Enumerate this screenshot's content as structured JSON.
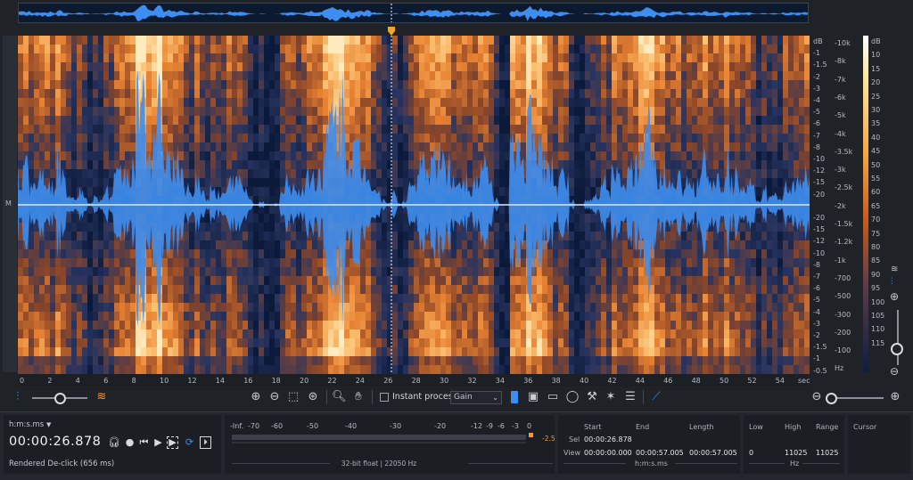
{
  "spectrogram": {
    "channel_label": "M",
    "time_ticks": [
      "0",
      "2",
      "4",
      "6",
      "8",
      "10",
      "12",
      "14",
      "16",
      "18",
      "20",
      "22",
      "24",
      "26",
      "28",
      "30",
      "32",
      "34",
      "36",
      "38",
      "40",
      "42",
      "44",
      "46",
      "48",
      "50",
      "52",
      "54",
      "sec"
    ],
    "db_ticks": [
      "dB",
      "-1",
      "-1.5",
      "-2",
      "-3",
      "-4",
      "-5",
      "-6",
      "-7",
      "-8",
      "-10",
      "-12",
      "-15",
      "-20",
      "",
      "-20",
      "-15",
      "-12",
      "-10",
      "-8",
      "-7",
      "-6",
      "-5",
      "-4",
      "-3",
      "-2",
      "-1.5",
      "-1",
      "-0.5"
    ],
    "hz_ticks": [
      "-10k",
      "-8k",
      "-7k",
      "-6k",
      "-5k",
      "-4k",
      "-3.5k",
      "-3k",
      "-2.5k",
      "-2k",
      "-1.5k",
      "-1.2k",
      "-1k",
      "-700",
      "-500",
      "-300",
      "-200",
      "-100",
      "Hz"
    ],
    "colorbar_ticks": [
      "dB",
      "10",
      "15",
      "20",
      "25",
      "30",
      "35",
      "40",
      "45",
      "50",
      "55",
      "60",
      "65",
      "70",
      "75",
      "80",
      "85",
      "90",
      "95",
      "100",
      "105",
      "110",
      "115"
    ],
    "colors": {
      "waveform": "#3d8ef0",
      "spectro_hot": "#f39a3a",
      "spectro_cold": "#0b1a3a",
      "playhead": "#f5a623"
    }
  },
  "toolbar": {
    "instant_process_label": "Instant process",
    "gain_select_value": "Gain",
    "icons": [
      "waveform-icon",
      "spectrogram-icon",
      "zoom-in-icon",
      "zoom-out-icon",
      "zoom-selection-icon",
      "zoom-fit-icon",
      "zoom-icon",
      "hand-icon",
      "time-select-icon",
      "rect-select-icon",
      "freq-select-icon",
      "lasso-icon",
      "magic-wand-icon",
      "brush-icon",
      "harmonics-icon",
      "link-icon",
      "zoom-out-v-icon",
      "zoom-in-v-icon"
    ]
  },
  "transport": {
    "time_format": "h:m:s.ms",
    "timecode": "00:00:26.878",
    "status": "Rendered De-click (656 ms)"
  },
  "meter": {
    "ticks": [
      "-Inf.",
      "-70",
      "-60",
      "-50",
      "-40",
      "-30",
      "-20",
      "-12",
      "-9",
      "-6",
      "-3",
      "0"
    ],
    "peak_value": "-2.5",
    "footer": "32-bit float | 22050 Hz"
  },
  "selection": {
    "start_header": "Start",
    "end_header": "End",
    "length_header": "Length",
    "sel_label": "Sel",
    "view_label": "View",
    "sel_start": "00:00:26.878",
    "view_start": "00:00:00.000",
    "view_end": "00:00:57.005",
    "view_length": "00:00:57.005",
    "footer": "h:m:s.ms"
  },
  "frequency": {
    "low_header": "Low",
    "high_header": "High",
    "range_header": "Range",
    "low": "0",
    "high": "11025",
    "range": "11025",
    "footer": "Hz"
  },
  "cursor": {
    "header": "Cursor"
  }
}
